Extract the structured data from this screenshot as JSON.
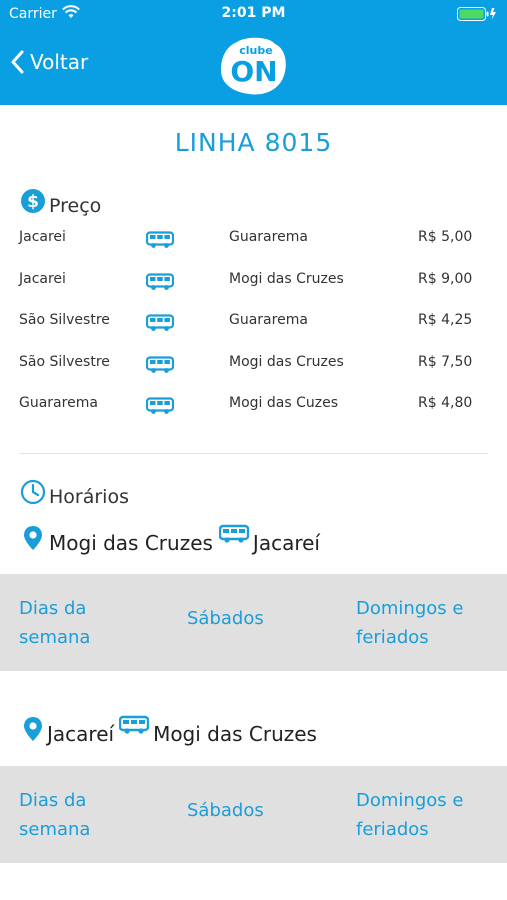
{
  "status": {
    "carrier": "Carrier",
    "time": "2:01 PM"
  },
  "nav": {
    "back_label": "Voltar",
    "logo_top": "clube",
    "logo_main": "ON"
  },
  "title": "LINHA 8015",
  "price_section": {
    "heading": "Preço",
    "rows": [
      {
        "from": "Jacarei",
        "to": "Guararema",
        "price": "R$ 5,00"
      },
      {
        "from": "Jacarei",
        "to": "Mogi das Cruzes",
        "price": "R$ 9,00"
      },
      {
        "from": "São Silvestre",
        "to": "Guararema",
        "price": "R$ 4,25"
      },
      {
        "from": "São Silvestre",
        "to": "Mogi das Cruzes",
        "price": "R$ 7,50"
      },
      {
        "from": "Guararema",
        "to": "Mogi das Cuzes",
        "price": "R$ 4,80"
      }
    ]
  },
  "schedule_section": {
    "heading": "Horários",
    "routes": [
      {
        "from": "Mogi das Cruzes",
        "to": "Jacareí",
        "tabs": {
          "weekdays_line1": "Dias da",
          "weekdays_line2": "semana",
          "saturdays": "Sábados",
          "sundays_line1": "Domingos e",
          "sundays_line2": "feriados"
        }
      },
      {
        "from": "Jacareí",
        "to": "Mogi das Cruzes",
        "tabs": {
          "weekdays_line1": "Dias da",
          "weekdays_line2": "semana",
          "saturdays": "Sábados",
          "sundays_line1": "Domingos e",
          "sundays_line2": "feriados"
        }
      }
    ]
  },
  "colors": {
    "brand_blue": "#0a9fe3",
    "text_blue": "#1a9ed9",
    "band_grey": "#e0e0e0"
  },
  "icons": [
    "wifi-icon",
    "battery-icon",
    "chevron-left-icon",
    "dollar-icon",
    "bus-icon",
    "clock-icon",
    "location-pin-icon"
  ]
}
